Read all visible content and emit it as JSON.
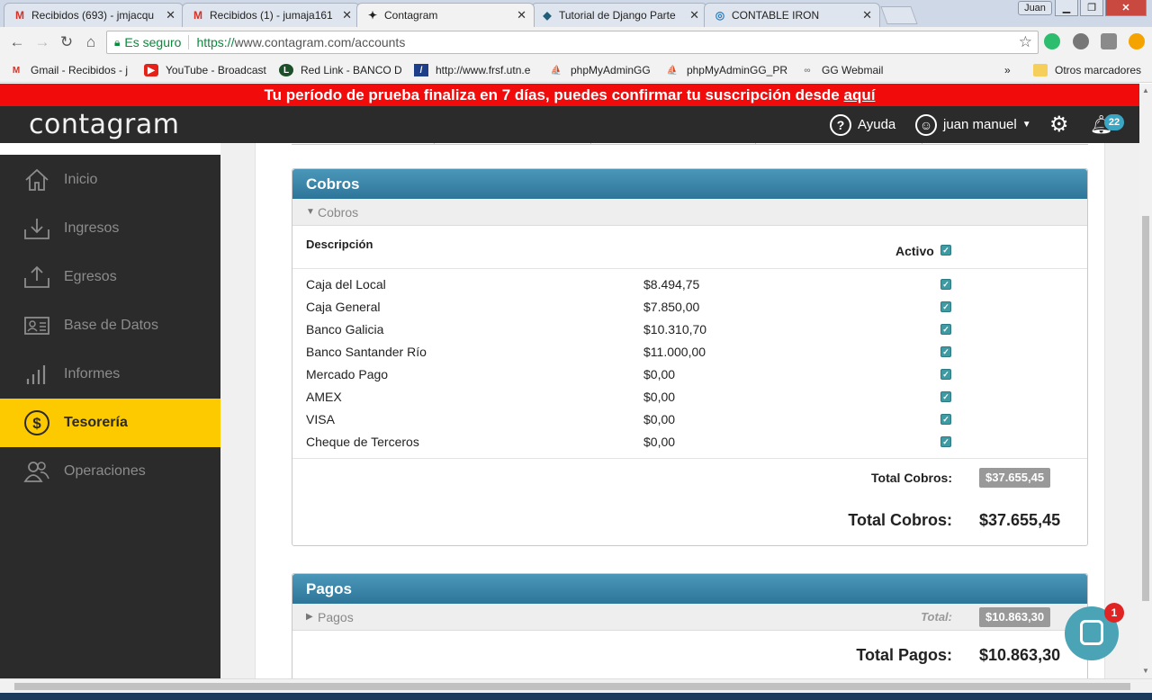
{
  "browser": {
    "tabs": [
      {
        "title": "Recibidos (693) - jmjacqu",
        "icon": "gmail-icon"
      },
      {
        "title": "Recibidos (1) - jumaja161",
        "icon": "gmail-icon"
      },
      {
        "title": "Contagram",
        "icon": "contagram-icon"
      },
      {
        "title": "Tutorial de Django Parte",
        "icon": "django-icon"
      },
      {
        "title": "CONTABLE IRON",
        "icon": "contable-icon"
      }
    ],
    "user_chip": "Juan",
    "secure_label": "Es seguro",
    "url_scheme": "https://",
    "url_rest": "www.contagram.com/accounts",
    "bookmarks": [
      "Gmail - Recibidos - j",
      "YouTube - Broadcast",
      "Red Link - BANCO D",
      "http://www.frsf.utn.e",
      "phpMyAdminGG",
      "phpMyAdminGG_PR",
      "GG Webmail"
    ],
    "other_bookmarks": "Otros marcadores"
  },
  "trial_banner": {
    "text": "Tu período de prueba finaliza en 7 días, puedes confirmar tu suscripción desde ",
    "link": "aquí"
  },
  "topnav": {
    "logo": "contagram",
    "help": "Ayuda",
    "user": "juan manuel",
    "notifications": "22"
  },
  "sidebar": {
    "items": [
      {
        "label": "Inicio",
        "icon": "home-icon"
      },
      {
        "label": "Ingresos",
        "icon": "download-tray-icon"
      },
      {
        "label": "Egresos",
        "icon": "upload-tray-icon"
      },
      {
        "label": "Base de Datos",
        "icon": "contact-card-icon"
      },
      {
        "label": "Informes",
        "icon": "bar-chart-icon"
      },
      {
        "label": "Tesorería",
        "icon": "dollar-coin-icon"
      },
      {
        "label": "Operaciones",
        "icon": "users-icon"
      }
    ],
    "active_index": 5
  },
  "cobros": {
    "title": "Cobros",
    "subheader": "Cobros",
    "col_description": "Descripción",
    "col_active": "Activo",
    "rows": [
      {
        "description": "Caja del Local",
        "amount": "$8.494,75"
      },
      {
        "description": "Caja General",
        "amount": "$7.850,00"
      },
      {
        "description": "Banco Galicia",
        "amount": "$10.310,70"
      },
      {
        "description": "Banco Santander Río",
        "amount": "$11.000,00"
      },
      {
        "description": "Mercado Pago",
        "amount": "$0,00"
      },
      {
        "description": "AMEX",
        "amount": "$0,00"
      },
      {
        "description": "VISA",
        "amount": "$0,00"
      },
      {
        "description": "Cheque de Terceros",
        "amount": "$0,00"
      }
    ],
    "total_label": "Total Cobros:",
    "total_value": "$37.655,45",
    "big_total_label": "Total Cobros:",
    "big_total_value": "$37.655,45"
  },
  "pagos": {
    "title": "Pagos",
    "subheader": "Pagos",
    "total_label": "Total:",
    "total_value": "$10.863,30",
    "big_total_label": "Total Pagos:",
    "big_total_value": "$10.863,30"
  },
  "chat": {
    "unread": "1"
  },
  "colors": {
    "trial_banner": "#f10b0b",
    "dark_nav": "#2b2b2b",
    "active_menu": "#fdca00",
    "panel_header": "#3a86aa",
    "checkbox": "#3e9aa3",
    "chat_bubble": "#4aa4b5"
  }
}
